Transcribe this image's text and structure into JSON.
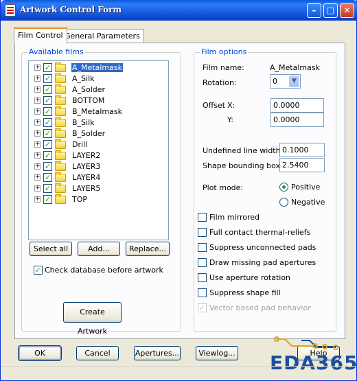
{
  "window": {
    "title": "Artwork Control Form",
    "controls": [
      "minimize-icon",
      "maximize-icon",
      "close-icon"
    ]
  },
  "tabs": [
    {
      "label": "Film Control",
      "active": true
    },
    {
      "label": "General Parameters",
      "active": false
    }
  ],
  "available_films": {
    "title": "Available films",
    "items": [
      {
        "label": "A_Metalmask",
        "checked": true,
        "selected": true
      },
      {
        "label": "A_Silk",
        "checked": true
      },
      {
        "label": "A_Solder",
        "checked": true
      },
      {
        "label": "BOTTOM",
        "checked": true
      },
      {
        "label": "B_Metalmask",
        "checked": true
      },
      {
        "label": "B_Silk",
        "checked": true
      },
      {
        "label": "B_Solder",
        "checked": true
      },
      {
        "label": "Drill",
        "checked": true
      },
      {
        "label": "LAYER2",
        "checked": true
      },
      {
        "label": "LAYER3",
        "checked": true
      },
      {
        "label": "LAYER4",
        "checked": true
      },
      {
        "label": "LAYER5",
        "checked": true
      },
      {
        "label": "TOP",
        "checked": true
      }
    ],
    "select_all": "Select all",
    "add": "Add...",
    "replace": "Replace...",
    "check_db_label": "Check database before artwork",
    "check_db_checked": true,
    "create_artwork": "Create Artwork"
  },
  "film_options": {
    "title": "Film options",
    "film_name_label": "Film name:",
    "film_name_value": "A_Metalmask",
    "rotation_label": "Rotation:",
    "rotation_value": "0",
    "offset_label": "Offset",
    "offset_x_label": "X:",
    "offset_x_value": "0.0000",
    "offset_y_label": "Y:",
    "offset_y_value": "0.0000",
    "undefined_line_width_label": "Undefined line width:",
    "undefined_line_width_value": "0.1000",
    "shape_bounding_box_label": "Shape bounding box:",
    "shape_bounding_box_value": "2.5400",
    "plot_mode_label": "Plot mode:",
    "plot_mode_positive": "Positive",
    "plot_mode_negative": "Negative",
    "plot_mode_selected": "Positive",
    "options": [
      {
        "label": "Film mirrored",
        "checked": false,
        "enabled": true
      },
      {
        "label": "Full contact thermal-reliefs",
        "checked": false,
        "enabled": true
      },
      {
        "label": "Suppress unconnected pads",
        "checked": false,
        "enabled": true
      },
      {
        "label": "Draw missing pad apertures",
        "checked": false,
        "enabled": true
      },
      {
        "label": "Use aperture rotation",
        "checked": false,
        "enabled": true
      },
      {
        "label": "Suppress shape fill",
        "checked": false,
        "enabled": true
      },
      {
        "label": "Vector based pad behavior",
        "checked": true,
        "enabled": false
      }
    ]
  },
  "footer": {
    "ok": "OK",
    "cancel": "Cancel",
    "apertures": "Apertures...",
    "viewlog": "Viewlog...",
    "help": "Help"
  },
  "watermark": "EDA365",
  "colors": {
    "titlebar": "#0a5ae0",
    "group_title": "#0046d5",
    "selection": "#316ac5",
    "check": "#21a121"
  }
}
